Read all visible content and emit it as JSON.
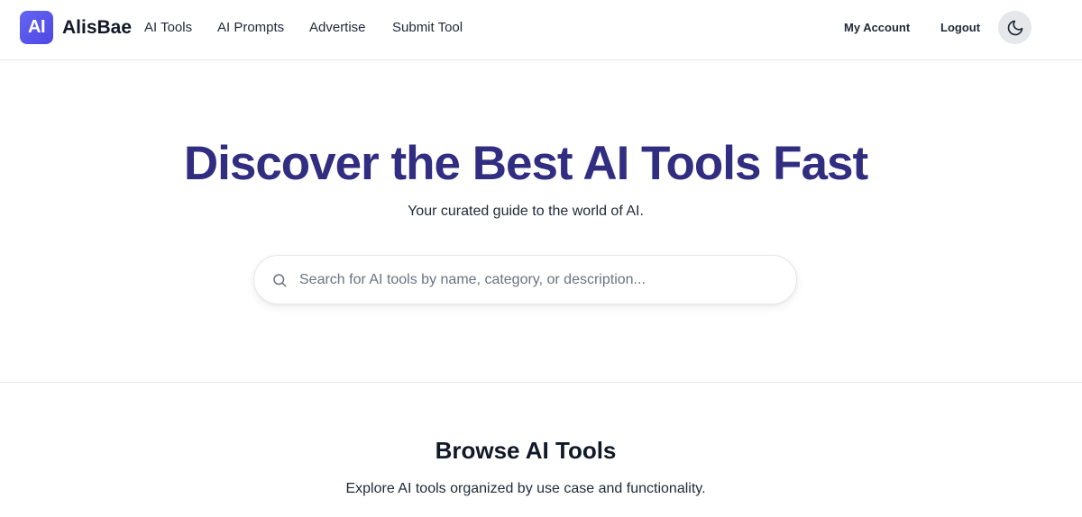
{
  "header": {
    "logo_text": "AI",
    "brand": "AlisBae",
    "nav": [
      {
        "label": "AI Tools"
      },
      {
        "label": "AI Prompts"
      },
      {
        "label": "Advertise"
      },
      {
        "label": "Submit Tool"
      }
    ],
    "account_label": "My Account",
    "logout_label": "Logout",
    "theme_icon": "moon-icon"
  },
  "hero": {
    "title": "Discover the Best AI Tools Fast",
    "subtitle": "Your curated guide to the world of AI.",
    "search": {
      "placeholder": "Search for AI tools by name, category, or description...",
      "value": "",
      "icon": "search-icon"
    }
  },
  "browse": {
    "title": "Browse AI Tools",
    "description": "Explore AI tools organized by use case and functionality."
  },
  "colors": {
    "accent": "#4f46e5",
    "hero_title": "#312e81",
    "toggle_bg": "#e5e7eb"
  }
}
